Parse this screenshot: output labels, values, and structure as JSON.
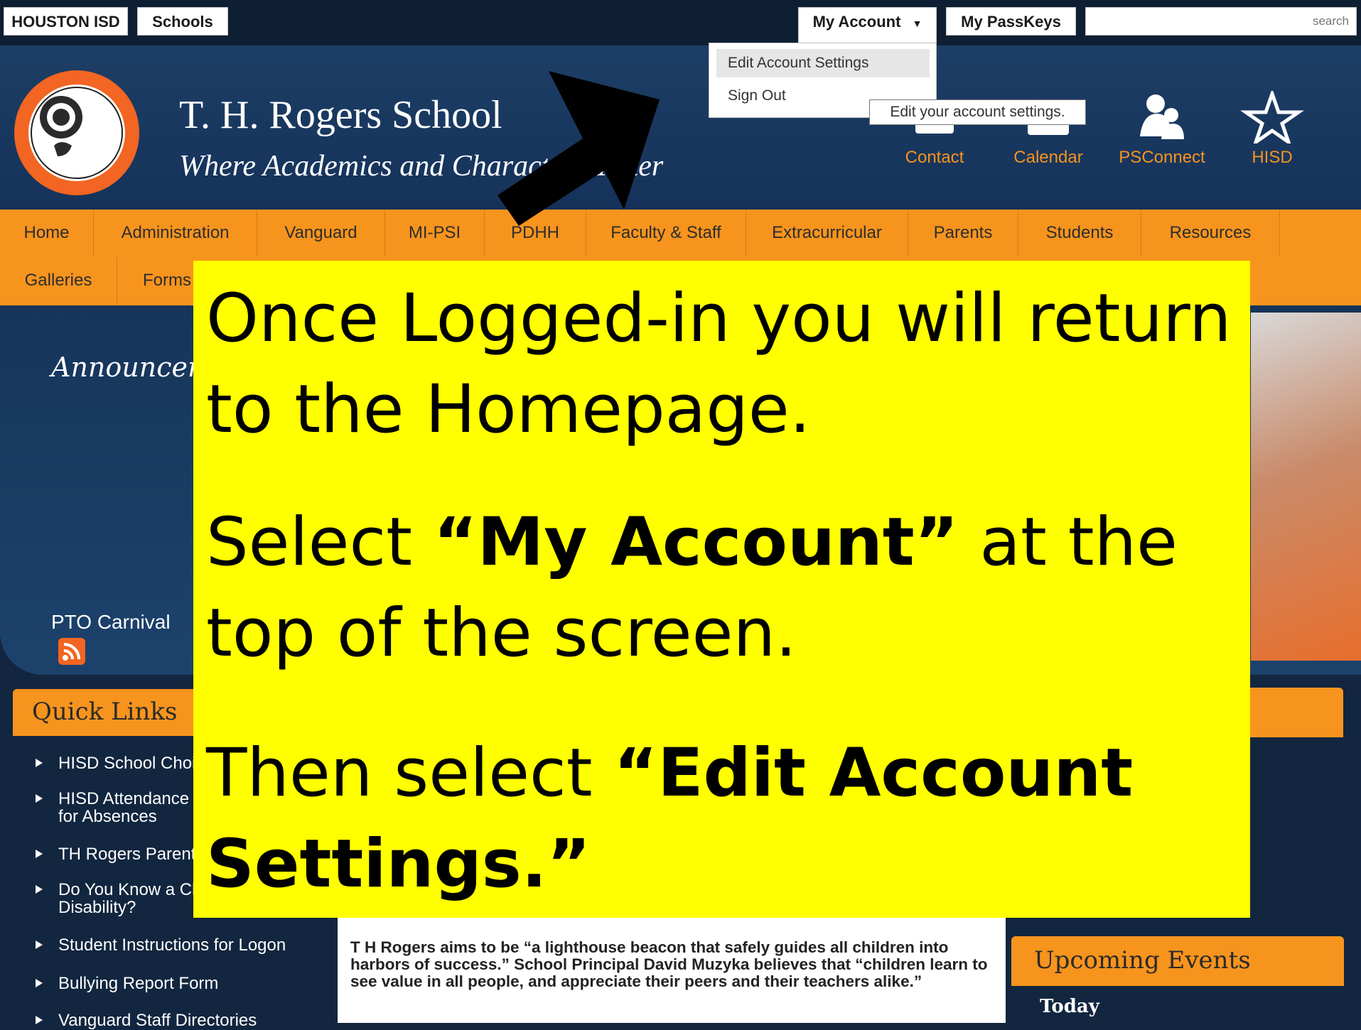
{
  "topbar": {
    "district_label": "HOUSTON ISD",
    "schools_label": "Schools",
    "my_account_label": "My Account",
    "passkeys_label": "My PassKeys",
    "search_placeholder": "search"
  },
  "account_menu": {
    "edit_label": "Edit Account Settings",
    "signout_label": "Sign Out",
    "tooltip": "Edit your account settings."
  },
  "header": {
    "school_name": "T. H. Rogers School",
    "tagline": "Where Academics and Character Matter",
    "quick_icons": [
      {
        "label": "Contact",
        "icon": "contact-icon"
      },
      {
        "label": "Calendar",
        "icon": "calendar-icon"
      },
      {
        "label": "PSConnect",
        "icon": "people-icon"
      },
      {
        "label": "HISD",
        "icon": "star-icon"
      }
    ]
  },
  "nav": {
    "row1": [
      "Home",
      "Administration",
      "Vanguard",
      "MI-PSI",
      "PDHH",
      "Faculty & Staff",
      "Extracurricular",
      "Parents",
      "Students",
      "Resources"
    ],
    "row2": [
      "Galleries",
      "Forms"
    ]
  },
  "announcements": {
    "title": "Announcements",
    "pto_text": "PTO Carnival"
  },
  "quick_links": {
    "title": "Quick Links",
    "items": [
      "HISD School Choice",
      "HISD Attendance Policy for Absences",
      "TH Rogers Parent",
      "Do You Know a Child with a Disability?",
      "Student Instructions for Logon",
      "Bullying Report Form",
      "Vanguard Staff Directories"
    ]
  },
  "article": {
    "text": "T H Rogers aims to be “a lighthouse beacon that safely guides all children into harbors of success.” School Principal David Muzyka believes that “children learn to see value in all people, and appreciate their peers and their teachers alike.”"
  },
  "upcoming": {
    "title": "Upcoming Events",
    "today_label": "Today"
  },
  "callout": {
    "line1": "Once Logged-in you will return",
    "line2": "to the Homepage.",
    "line3_pre": "Select ",
    "line3_bold": "“My Account”",
    "line3_post": " at the",
    "line4": "top of the screen.",
    "line5_pre": "Then select ",
    "line5_bold": "“Edit Account",
    "line6_bold": "Settings.”"
  },
  "colors": {
    "header_blue": "#1d3e66",
    "nav_orange": "#f7941d",
    "callout_yellow": "#ffff00"
  }
}
